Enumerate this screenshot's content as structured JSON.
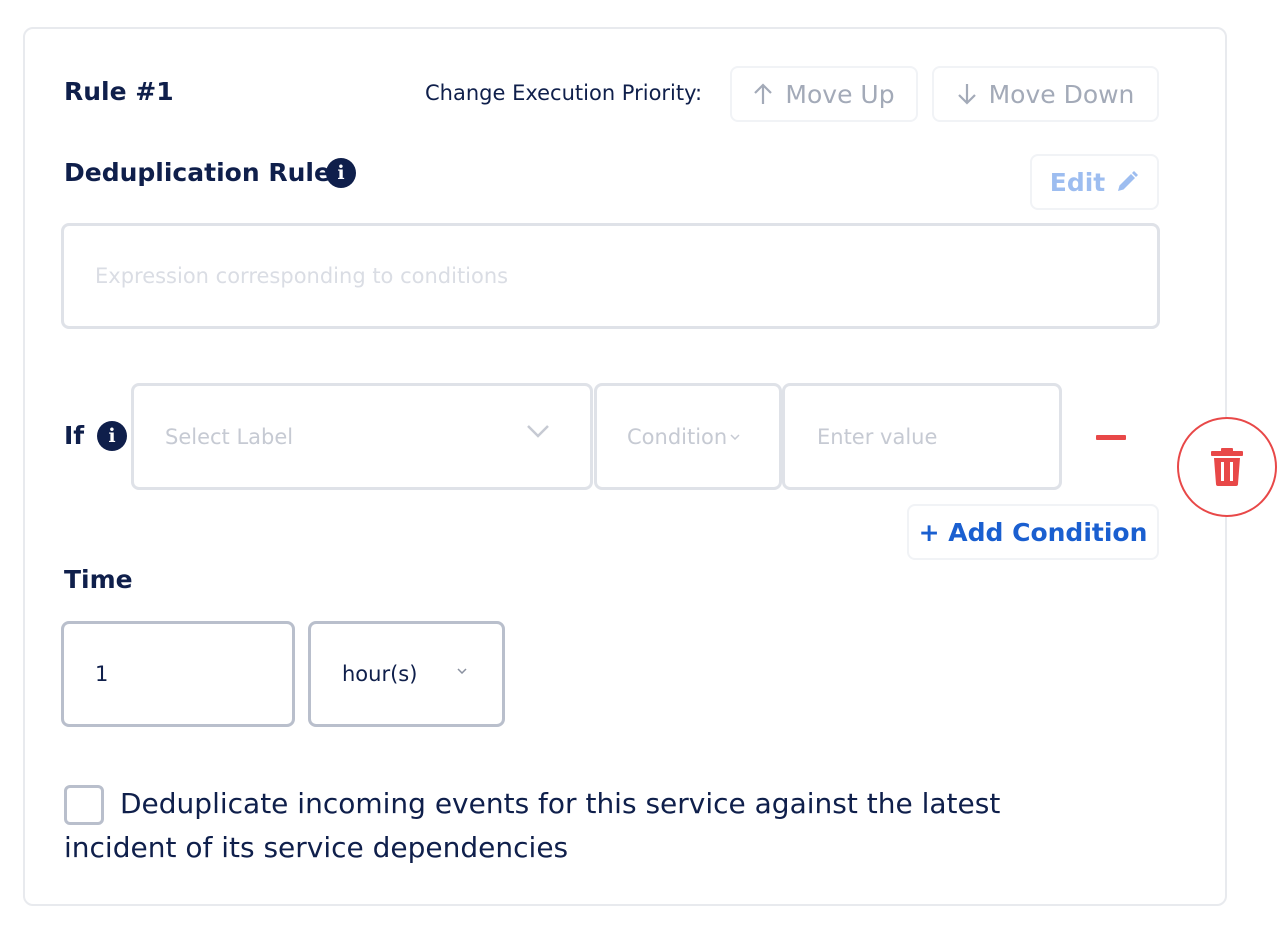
{
  "rule": {
    "title": "Rule #1",
    "priority_label": "Change Execution Priority:",
    "move_up_label": "Move Up",
    "move_down_label": "Move Down"
  },
  "dedup": {
    "title": "Deduplication Rule",
    "edit_label": "Edit",
    "expression_placeholder": "Expression corresponding to conditions"
  },
  "condition": {
    "if_label": "If",
    "select_label_placeholder": "Select Label",
    "condition_placeholder": "Condition",
    "value_placeholder": "Enter value",
    "add_condition_label": "+ Add Condition"
  },
  "time": {
    "title": "Time",
    "value": "1",
    "unit": "hour(s)"
  },
  "dependency": {
    "checked": false,
    "label": "Deduplicate incoming events for this service against the latest incident of its service dependencies"
  },
  "colors": {
    "primary": "#0f1f4b",
    "link": "#1a5fd0",
    "danger": "#e84848",
    "edit": "#9dbdf0"
  },
  "icons": [
    "arrow-up-icon",
    "arrow-down-icon",
    "info-icon",
    "pencil-icon",
    "chevron-down-icon",
    "minus-icon",
    "trash-icon"
  ]
}
